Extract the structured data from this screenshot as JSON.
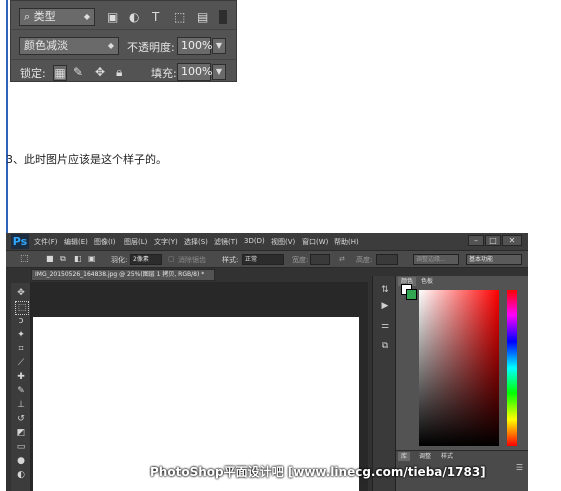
{
  "layers_panel": {
    "filter_label": "类型",
    "blend_mode": "颜色减淡",
    "opacity_label": "不透明度:",
    "opacity_value": "100%",
    "lock_label": "锁定:",
    "fill_label": "填充:",
    "fill_value": "100%"
  },
  "caption": "3、此时图片应该是这个样子的。",
  "photoshop": {
    "logo": "Ps",
    "menu": [
      "文件(F)",
      "编辑(E)",
      "图像(I)",
      "图层(L)",
      "文字(Y)",
      "选择(S)",
      "滤镜(T)",
      "3D(D)",
      "视图(V)",
      "窗口(W)",
      "帮助(H)"
    ],
    "options": {
      "feather_label": "羽化:",
      "feather_value": "2像素",
      "antialias_label": "消除锯齿",
      "style_label": "样式:",
      "style_value": "正常",
      "width_label": "宽度:",
      "height_label": "高度:",
      "refine_button": "调整边缘...",
      "workspace": "基本功能"
    },
    "doc_tab": "IMG_20150526_164838.jpg @ 25%(图层 1 拷贝, RGB/8) *",
    "color_tabs": [
      "颜色",
      "色板"
    ],
    "lib_tabs": [
      "库",
      "调整",
      "样式"
    ],
    "foreground_color": "#ffffff",
    "background_color": "#33a652"
  },
  "watermark": "PhotoShop平面设计吧 [www.linecg.com/tieba/1783]"
}
